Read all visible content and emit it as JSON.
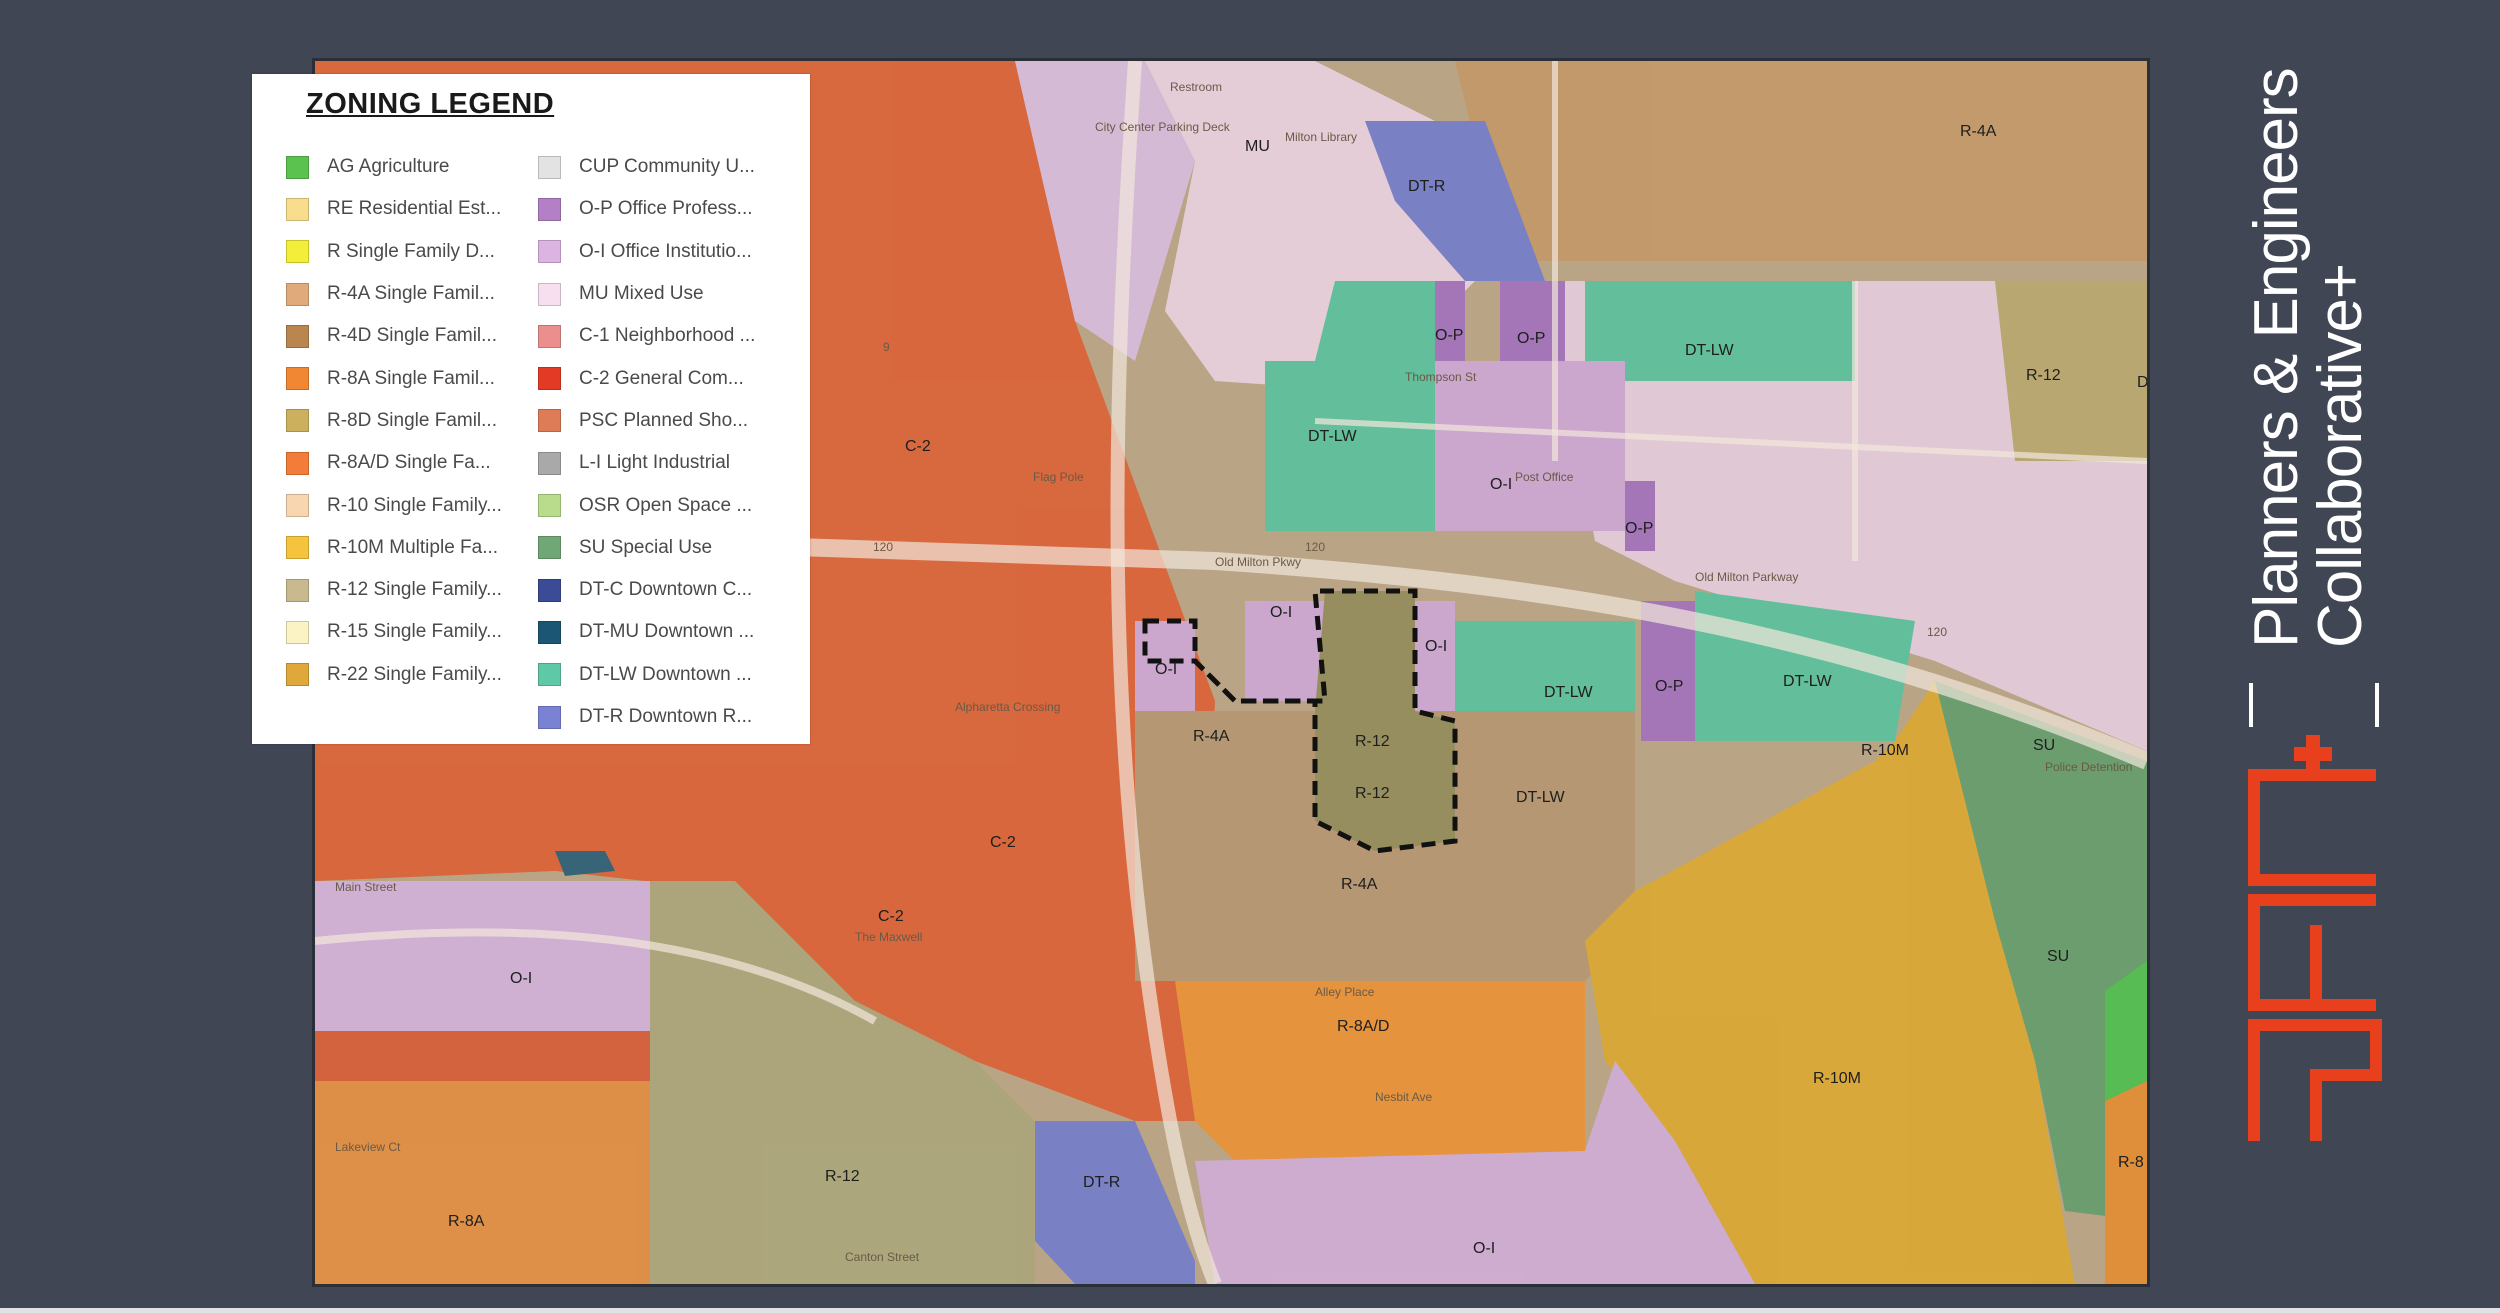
{
  "legend": {
    "title": "ZONING LEGEND",
    "column_1": [
      {
        "label": "AG Agriculture",
        "color": "#5cc24f"
      },
      {
        "label": "RE Residential Est...",
        "color": "#f8dd8c"
      },
      {
        "label": "R Single Family D...",
        "color": "#f2ee3a"
      },
      {
        "label": "R-4A Single Famil...",
        "color": "#e0aa7a"
      },
      {
        "label": "R-4D Single Famil...",
        "color": "#b9864f"
      },
      {
        "label": "R-8A Single Famil...",
        "color": "#f28733"
      },
      {
        "label": "R-8D Single Famil...",
        "color": "#cdb05e"
      },
      {
        "label": "R-8A/D Single Fa...",
        "color": "#f27d3a"
      },
      {
        "label": "R-10 Single Family...",
        "color": "#f8d6b0"
      },
      {
        "label": "R-10M Multiple Fa...",
        "color": "#f5c33c"
      },
      {
        "label": "R-12 Single Family...",
        "color": "#c8b98e"
      },
      {
        "label": "R-15 Single Family...",
        "color": "#fbf3c4"
      },
      {
        "label": "R-22 Single Family...",
        "color": "#e0a83a"
      }
    ],
    "column_2": [
      {
        "label": "CUP Community U...",
        "color": "#e3e3e3"
      },
      {
        "label": "O-P Office Profess...",
        "color": "#b37fc6"
      },
      {
        "label": "O-I Office Institutio...",
        "color": "#dcb4e2"
      },
      {
        "label": "MU Mixed Use",
        "color": "#f7dff0"
      },
      {
        "label": "C-1 Neighborhood ...",
        "color": "#ea8e8e"
      },
      {
        "label": "C-2 General Com...",
        "color": "#e33a25"
      },
      {
        "label": "PSC Planned Sho...",
        "color": "#de7c58"
      },
      {
        "label": "L-I Light Industrial",
        "color": "#a9a9a9"
      },
      {
        "label": "OSR Open Space ...",
        "color": "#b8dc8b"
      },
      {
        "label": "SU Special Use",
        "color": "#6fa777"
      },
      {
        "label": "DT-C Downtown C...",
        "color": "#3c4b96"
      },
      {
        "label": "DT-MU Downtown ...",
        "color": "#1b5775"
      },
      {
        "label": "DT-LW Downtown ...",
        "color": "#5fc8a6"
      },
      {
        "label": "DT-R Downtown R...",
        "color": "#7a82d4"
      }
    ]
  },
  "map": {
    "zone_labels": {
      "c2_a": "C-2",
      "c2_b": "C-2",
      "c2_c": "C-2",
      "oi_west": "O-I",
      "oi_center": "O-I",
      "oi_small": "O-I",
      "oi_right": "O-I",
      "oi_postoffice": "O-I",
      "oi_south": "O-I",
      "mu": "MU",
      "dtr_north": "DT-R",
      "dtr_south": "DT-R",
      "r4a_ne": "R-4A",
      "r4a_mid": "R-4A",
      "r4a_south": "R-4A",
      "op_a": "O-P",
      "op_b": "O-P",
      "op_c": "O-P",
      "op_d": "O-P",
      "dtlw_a": "DT-LW",
      "dtlw_b": "DT-LW",
      "dtlw_c": "DT-LW",
      "dtlw_d": "DT-LW",
      "dtlw_e": "DT-LW",
      "r12_ne": "R-12",
      "r12_site_a": "R-12",
      "r12_site_b": "R-12",
      "r12_sw": "R-12",
      "r10m_a": "R-10M",
      "r10m_b": "R-10M",
      "su_a": "SU",
      "su_b": "SU",
      "r8ad": "R-8A/D",
      "r8a": "R-8A",
      "r8_edge": "R-8",
      "d_edge": "D"
    },
    "street_labels": {
      "restroom": "Restroom",
      "parking_deck": "City Center Parking Deck",
      "library": "Milton Library",
      "flag_pole": "Flag Pole",
      "route_120_a": "120",
      "route_120_b": "120",
      "route_120_c": "120",
      "route_9": "9",
      "old_milton_pkwy_a": "Old Milton Pkwy",
      "old_milton_pkwy_b": "Old Milton Parkway",
      "post_office": "Post Office",
      "thompson_st": "Thompson St",
      "canton_st": "Canton Street",
      "crossing": "Alpharetta Crossing",
      "maxwell": "The Maxwell",
      "main_st": "Main Street",
      "police": "Police Detention",
      "alley": "Alley Place",
      "nesbit": "Nesbit Ave",
      "lakeview": "Lakeview Ct"
    }
  },
  "brand": {
    "line1": "Planners & Engineers",
    "line2": "Collaborative+",
    "logo_text": "PEC+",
    "logo_color": "#e8401c"
  }
}
